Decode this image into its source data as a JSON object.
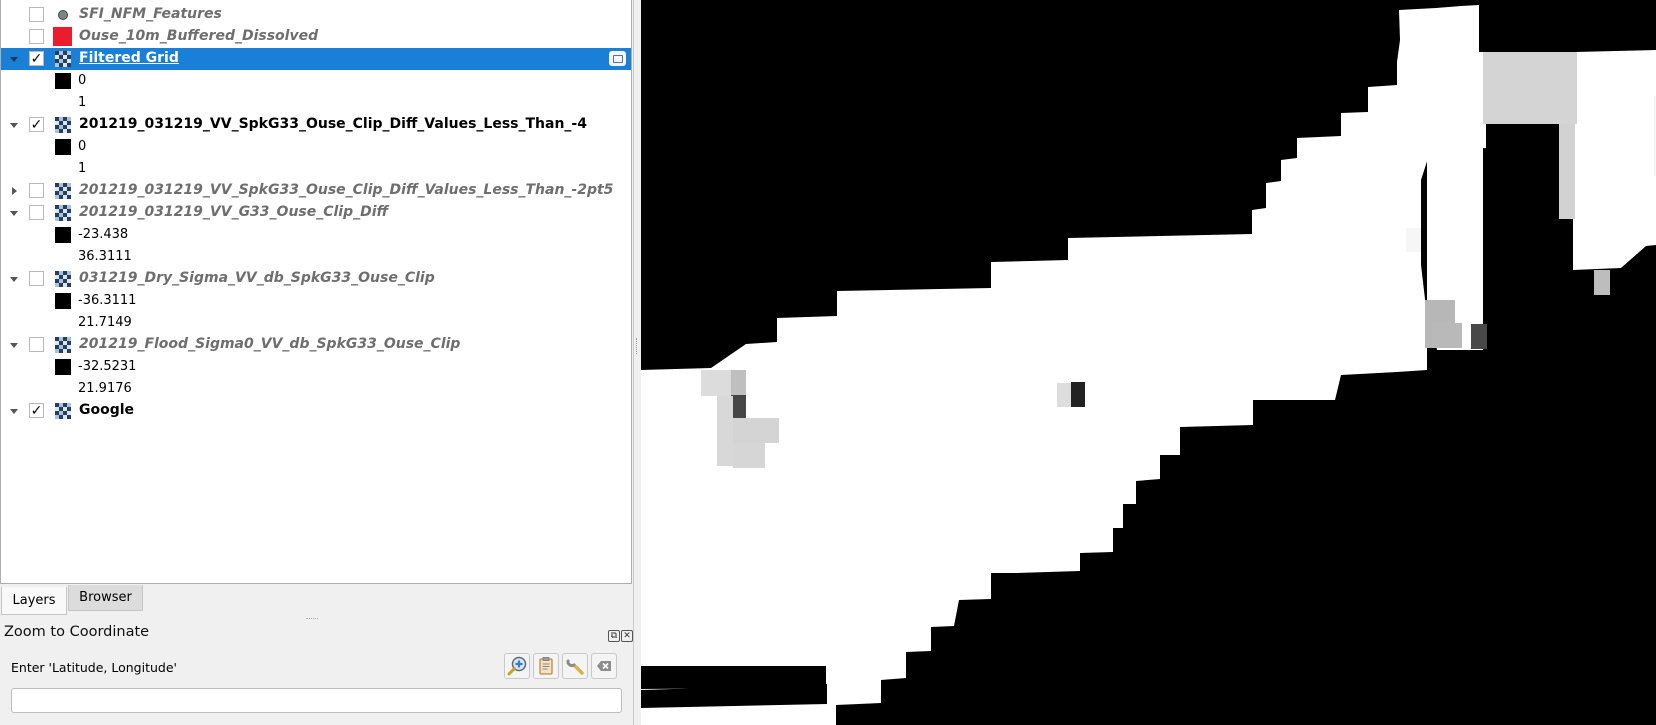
{
  "layers_panel": {
    "rows": [
      {
        "kind": "layer",
        "name": "SFI_NFM_Features",
        "checked": false,
        "expanded": null,
        "icon": "point-layer-icon",
        "visible_style": "inactive"
      },
      {
        "kind": "layer",
        "name": "Ouse_10m_Buffered_Dissolved",
        "checked": false,
        "expanded": null,
        "icon": "polygon-red-swatch",
        "swatch_color": "#ea1c2d",
        "visible_style": "inactive"
      },
      {
        "kind": "layer",
        "name": "Filtered Grid",
        "checked": true,
        "expanded": true,
        "icon": "raster-layer-icon",
        "selected": true,
        "indicator": "embedded-layer-icon"
      },
      {
        "kind": "legend",
        "value": "0",
        "swatch": "#000000"
      },
      {
        "kind": "legend",
        "value": "1",
        "swatch": "#ffffff"
      },
      {
        "kind": "layer",
        "name": "201219_031219_VV_SpkG33_Ouse_Clip_Diff_Values_Less_Than_-4",
        "checked": true,
        "expanded": true,
        "icon": "raster-layer-icon"
      },
      {
        "kind": "legend",
        "value": "0",
        "swatch": "#000000"
      },
      {
        "kind": "legend",
        "value": "1",
        "swatch": "#ffffff"
      },
      {
        "kind": "layer",
        "name": "201219_031219_VV_SpkG33_Ouse_Clip_Diff_Values_Less_Than_-2pt5",
        "checked": false,
        "expanded": false,
        "icon": "raster-layer-icon",
        "visible_style": "inactive"
      },
      {
        "kind": "layer",
        "name": "201219_031219_VV_G33_Ouse_Clip_Diff",
        "checked": false,
        "expanded": true,
        "icon": "raster-layer-icon",
        "visible_style": "inactive"
      },
      {
        "kind": "legend",
        "value": "-23.438",
        "swatch": "#000000"
      },
      {
        "kind": "legend",
        "value": "36.3111",
        "swatch": "#ffffff"
      },
      {
        "kind": "layer",
        "name": "031219_Dry_Sigma_VV_db_SpkG33_Ouse_Clip",
        "checked": false,
        "expanded": true,
        "icon": "raster-layer-icon",
        "visible_style": "inactive"
      },
      {
        "kind": "legend",
        "value": "-36.3111",
        "swatch": "#000000"
      },
      {
        "kind": "legend",
        "value": "21.7149",
        "swatch": "#ffffff"
      },
      {
        "kind": "layer",
        "name": "201219_Flood_Sigma0_VV_db_SpkG33_Ouse_Clip",
        "checked": false,
        "expanded": true,
        "icon": "raster-layer-icon",
        "visible_style": "inactive"
      },
      {
        "kind": "legend",
        "value": "-32.5231",
        "swatch": "#000000"
      },
      {
        "kind": "legend",
        "value": "21.9176",
        "swatch": "#ffffff"
      },
      {
        "kind": "layer",
        "name": "Google",
        "checked": true,
        "expanded": true,
        "icon": "raster-layer-icon"
      }
    ]
  },
  "tabs": [
    {
      "label": "Layers",
      "active": true
    },
    {
      "label": "Browser",
      "active": false
    }
  ],
  "zoom_to_coordinate": {
    "title": "Zoom to Coordinate",
    "label": "Enter 'Latitude, Longitude'",
    "input_value": "",
    "buttons": [
      {
        "name": "zoom-to-icon",
        "title": "Zoom"
      },
      {
        "name": "paste-icon",
        "title": "Paste"
      },
      {
        "name": "settings-wrench-icon",
        "title": "Settings"
      },
      {
        "name": "clear-icon",
        "title": "Clear"
      }
    ]
  },
  "colors": {
    "selection": "#1a7fd6",
    "map_background": "#000000",
    "map_foreground": "#ffffff"
  }
}
